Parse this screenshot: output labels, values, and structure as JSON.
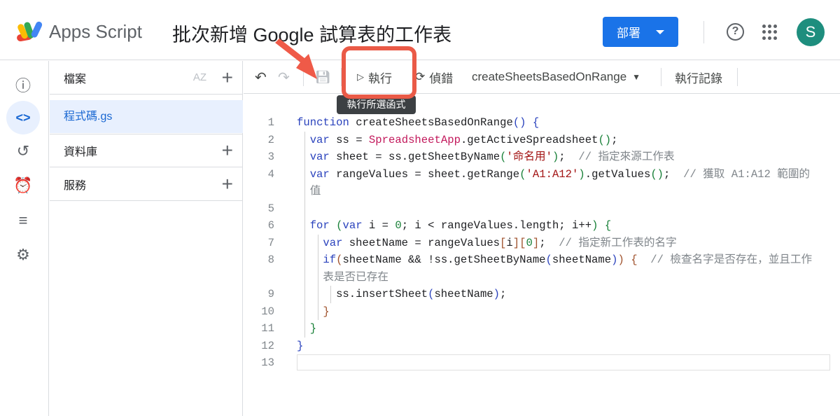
{
  "header": {
    "app_name": "Apps Script",
    "project_title": "批次新增 Google 試算表的工作表",
    "deploy_label": "部署",
    "help_icon": "?",
    "avatar_letter": "S"
  },
  "rail": {
    "items": [
      "overview",
      "editor",
      "executions",
      "triggers",
      "logs",
      "settings"
    ],
    "selected": "editor"
  },
  "files": {
    "header": "檔案",
    "sort_icon": "AZ",
    "files": [
      {
        "name": "程式碼.gs",
        "selected": true
      }
    ],
    "libraries_label": "資料庫",
    "services_label": "服務",
    "plus": "+"
  },
  "toolbar": {
    "run_label": "執行",
    "debug_label": "偵錯",
    "function_select": "createSheetsBasedOnRange",
    "log_label": "執行記錄",
    "tooltip": "執行所選函式"
  },
  "annotation": {
    "highlight_color": "#ea5a47"
  },
  "code": {
    "lines": [
      {
        "n": "1",
        "indent": 0,
        "tokens": [
          {
            "t": "k",
            "c": "function"
          },
          {
            "t": "f",
            "c": " createSheetsBasedOnRange"
          },
          {
            "t": "b1",
            "c": "()"
          },
          {
            "t": "o",
            "c": " "
          },
          {
            "t": "b1",
            "c": "{"
          }
        ]
      },
      {
        "n": "2",
        "indent": 1,
        "tokens": [
          {
            "t": "k",
            "c": "var"
          },
          {
            "t": "o",
            "c": " ss = "
          },
          {
            "t": "cls",
            "c": "SpreadsheetApp"
          },
          {
            "t": "o",
            "c": ".getActiveSpreadsheet"
          },
          {
            "t": "b2",
            "c": "()"
          },
          {
            "t": "o",
            "c": ";"
          }
        ]
      },
      {
        "n": "3",
        "indent": 1,
        "tokens": [
          {
            "t": "k",
            "c": "var"
          },
          {
            "t": "o",
            "c": " sheet = ss.getSheetByName"
          },
          {
            "t": "b2",
            "c": "("
          },
          {
            "t": "s",
            "c": "'命名用'"
          },
          {
            "t": "b2",
            "c": ")"
          },
          {
            "t": "o",
            "c": ";  "
          },
          {
            "t": "c",
            "c": "// 指定來源工作表"
          }
        ]
      },
      {
        "n": "4",
        "indent": 1,
        "tokens": [
          {
            "t": "k",
            "c": "var"
          },
          {
            "t": "o",
            "c": " rangeValues = sheet.getRange"
          },
          {
            "t": "b2",
            "c": "("
          },
          {
            "t": "s",
            "c": "'A1:A12'"
          },
          {
            "t": "b2",
            "c": ")"
          },
          {
            "t": "o",
            "c": ".getValues"
          },
          {
            "t": "b2",
            "c": "()"
          },
          {
            "t": "o",
            "c": ";  "
          },
          {
            "t": "c",
            "c": "// 獲取 A1:A12 範圍的"
          }
        ],
        "cont": [
          {
            "t": "c",
            "c": "值"
          }
        ]
      },
      {
        "n": "5",
        "indent": 1,
        "tokens": []
      },
      {
        "n": "6",
        "indent": 1,
        "tokens": [
          {
            "t": "k",
            "c": "for"
          },
          {
            "t": "o",
            "c": " "
          },
          {
            "t": "b2",
            "c": "("
          },
          {
            "t": "k",
            "c": "var"
          },
          {
            "t": "o",
            "c": " i = "
          },
          {
            "t": "n",
            "c": "0"
          },
          {
            "t": "o",
            "c": "; i < rangeValues.length; i++"
          },
          {
            "t": "b2",
            "c": ")"
          },
          {
            "t": "o",
            "c": " "
          },
          {
            "t": "b2",
            "c": "{"
          }
        ]
      },
      {
        "n": "7",
        "indent": 2,
        "tokens": [
          {
            "t": "k",
            "c": "var"
          },
          {
            "t": "o",
            "c": " sheetName = rangeValues"
          },
          {
            "t": "b3",
            "c": "["
          },
          {
            "t": "o",
            "c": "i"
          },
          {
            "t": "b3",
            "c": "]["
          },
          {
            "t": "n",
            "c": "0"
          },
          {
            "t": "b3",
            "c": "]"
          },
          {
            "t": "o",
            "c": ";  "
          },
          {
            "t": "c",
            "c": "// 指定新工作表的名字"
          }
        ]
      },
      {
        "n": "8",
        "indent": 2,
        "tokens": [
          {
            "t": "k",
            "c": "if"
          },
          {
            "t": "b3",
            "c": "("
          },
          {
            "t": "o",
            "c": "sheetName && !ss.getSheetByName"
          },
          {
            "t": "k",
            "c": "("
          },
          {
            "t": "o",
            "c": "sheetName"
          },
          {
            "t": "k",
            "c": ")"
          },
          {
            "t": "b3",
            "c": ")"
          },
          {
            "t": "o",
            "c": " "
          },
          {
            "t": "b3",
            "c": "{"
          },
          {
            "t": "o",
            "c": "  "
          },
          {
            "t": "c",
            "c": "// 檢查名字是否存在，並且工作"
          }
        ],
        "cont": [
          {
            "t": "c",
            "c": "表是否已存在"
          }
        ]
      },
      {
        "n": "9",
        "indent": 3,
        "tokens": [
          {
            "t": "o",
            "c": "ss.insertSheet"
          },
          {
            "t": "k",
            "c": "("
          },
          {
            "t": "o",
            "c": "sheetName"
          },
          {
            "t": "k",
            "c": ")"
          },
          {
            "t": "o",
            "c": ";"
          }
        ]
      },
      {
        "n": "10",
        "indent": 2,
        "tokens": [
          {
            "t": "b3",
            "c": "}"
          }
        ]
      },
      {
        "n": "11",
        "indent": 1,
        "tokens": [
          {
            "t": "b2",
            "c": "}"
          }
        ]
      },
      {
        "n": "12",
        "indent": 0,
        "tokens": [
          {
            "t": "b1",
            "c": "}"
          }
        ]
      },
      {
        "n": "13",
        "indent": 0,
        "tokens": []
      }
    ]
  }
}
